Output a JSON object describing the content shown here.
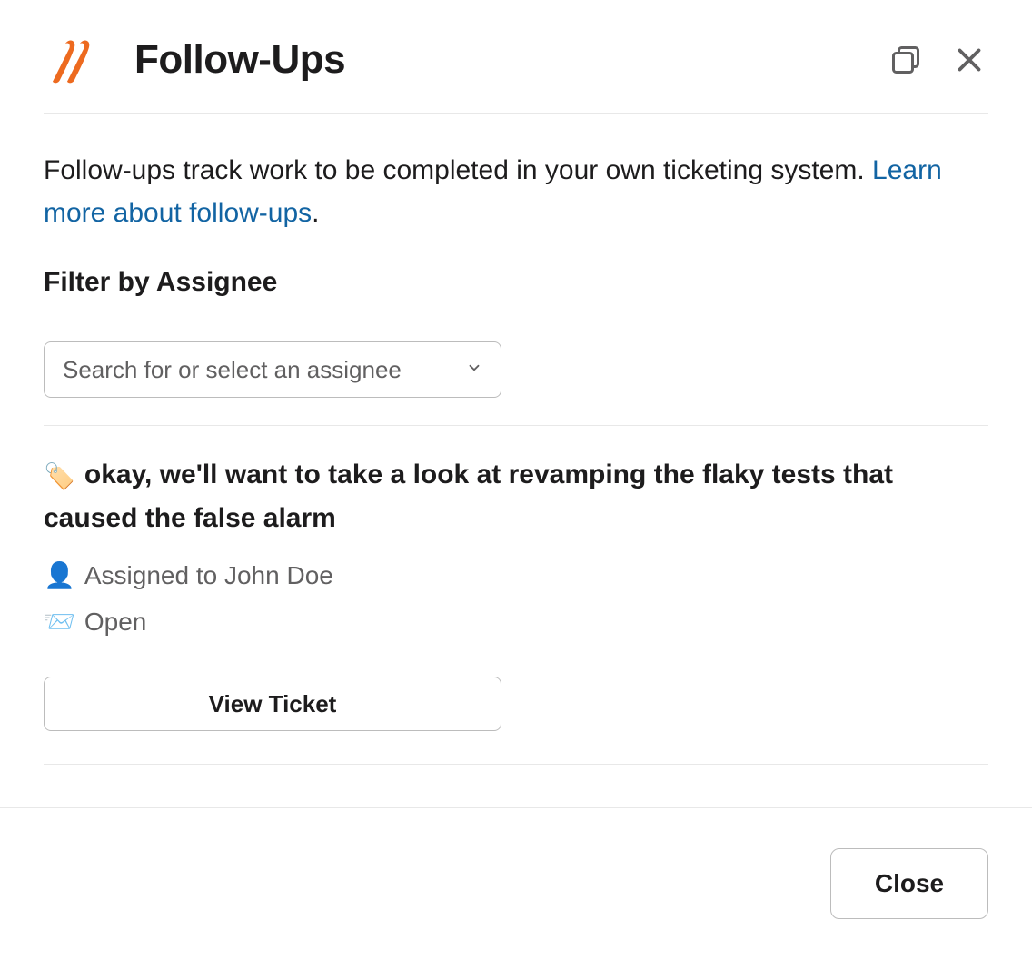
{
  "header": {
    "title": "Follow-Ups"
  },
  "intro": {
    "text": "Follow-ups track work to be completed in your own ticketing system. ",
    "link_text": "Learn more about follow-ups",
    "period": "."
  },
  "filter": {
    "label": "Filter by Assignee",
    "placeholder": "Search for or select an assignee"
  },
  "ticket": {
    "emoji": "🏷️",
    "title": "okay, we'll want to take a look at revamping the flaky tests that caused the false alarm",
    "assignee_emoji": "👤",
    "assignee_text": "Assigned to John Doe",
    "status_emoji": "📨",
    "status_text": "Open",
    "view_button": "View Ticket"
  },
  "footer": {
    "close_label": "Close"
  }
}
